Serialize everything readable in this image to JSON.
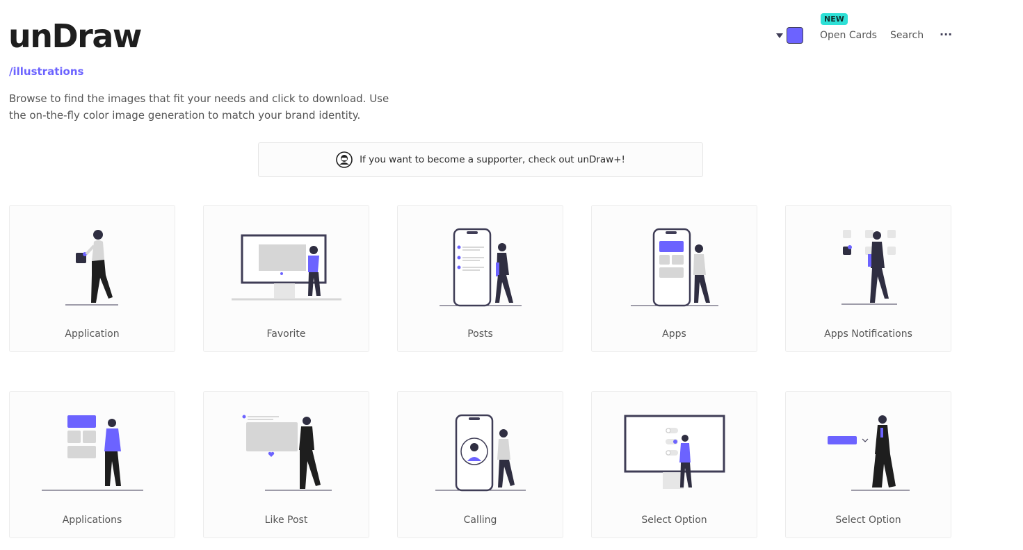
{
  "brand": {
    "logo": "unDraw",
    "subtitle": "/illustrations",
    "accent": "#6c63ff"
  },
  "intro": "Browse to find the images that fit your needs and click to download. Use the on-the-fly color image generation to match your brand identity.",
  "nav": {
    "color_picker": {
      "value": "#6c63ff",
      "icon": "chevron-down-icon"
    },
    "badge": "NEW",
    "open_cards": "Open Cards",
    "search": "Search",
    "more_icon": "ellipsis-icon",
    "more_label": "···"
  },
  "banner": {
    "icon": "supporter-avatar-icon",
    "text": "If you want to become a supporter, check out unDraw+!"
  },
  "cards": [
    {
      "label": "Application"
    },
    {
      "label": "Favorite"
    },
    {
      "label": "Posts"
    },
    {
      "label": "Apps"
    },
    {
      "label": "Apps Notifications"
    },
    {
      "label": "Applications"
    },
    {
      "label": "Like Post"
    },
    {
      "label": "Calling"
    },
    {
      "label": "Select Option"
    },
    {
      "label": "Select Option"
    }
  ]
}
